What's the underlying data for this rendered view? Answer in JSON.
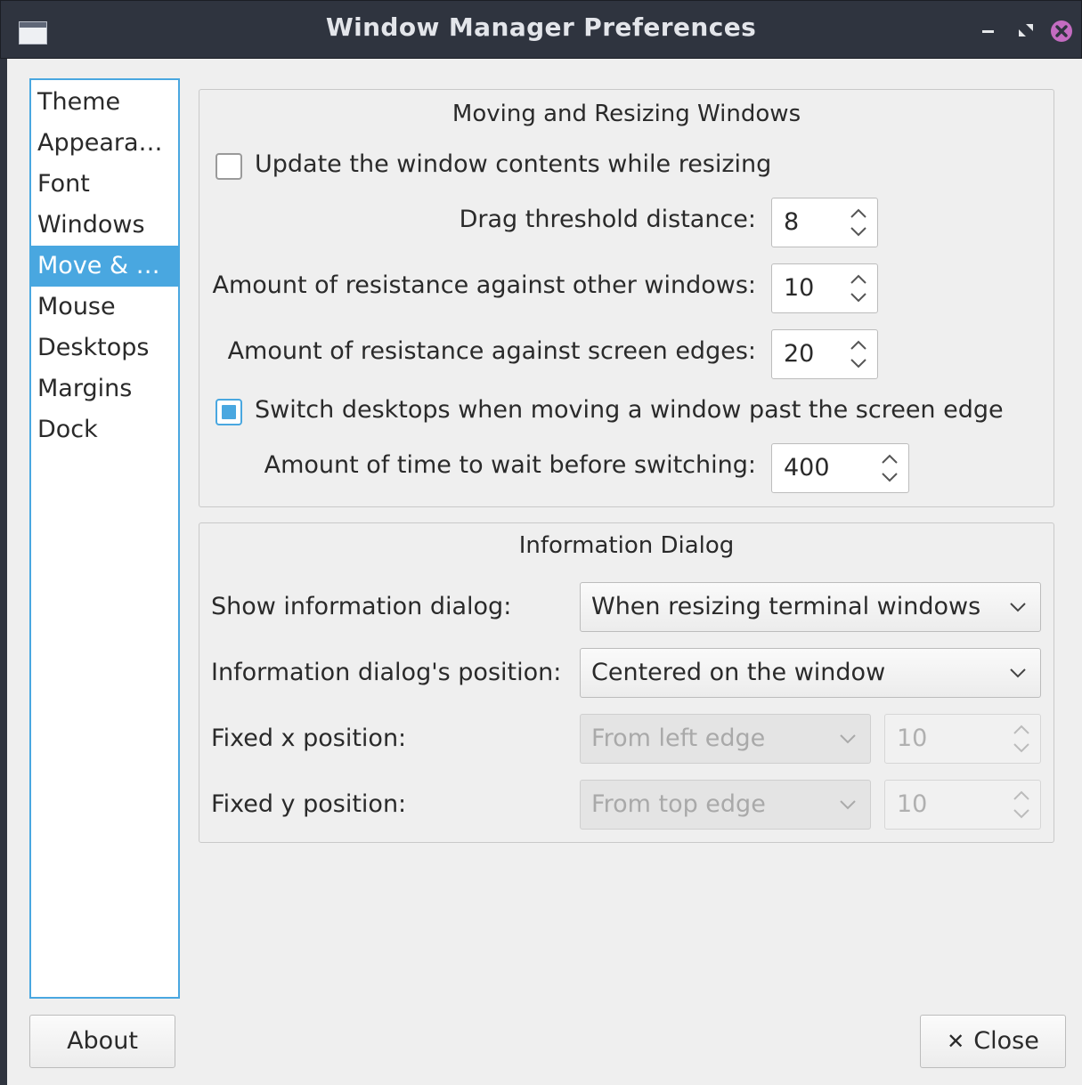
{
  "window": {
    "title": "Window Manager Preferences"
  },
  "sidebar": {
    "items": [
      {
        "label": "Theme",
        "selected": false
      },
      {
        "label": "Appeara…",
        "selected": false
      },
      {
        "label": "Font",
        "selected": false
      },
      {
        "label": "Windows",
        "selected": false
      },
      {
        "label": "Move & …",
        "selected": true
      },
      {
        "label": "Mouse",
        "selected": false
      },
      {
        "label": "Desktops",
        "selected": false
      },
      {
        "label": "Margins",
        "selected": false
      },
      {
        "label": "Dock",
        "selected": false
      }
    ]
  },
  "moving": {
    "title": "Moving and Resizing Windows",
    "update_contents": {
      "label": "Update the window contents while resizing",
      "checked": false
    },
    "drag_threshold": {
      "label": "Drag threshold distance:",
      "value": "8"
    },
    "resist_windows": {
      "label": "Amount of resistance against other windows:",
      "value": "10"
    },
    "resist_edges": {
      "label": "Amount of resistance against screen edges:",
      "value": "20"
    },
    "switch_desktops": {
      "label": "Switch desktops when moving a window past the screen edge",
      "checked": true
    },
    "switch_wait": {
      "label": "Amount of time to wait before switching:",
      "value": "400"
    }
  },
  "info": {
    "title": "Information Dialog",
    "show": {
      "label": "Show information dialog:",
      "value": "When resizing terminal windows"
    },
    "position": {
      "label": "Information dialog's position:",
      "value": "Centered on the window"
    },
    "fixed_x": {
      "label": "Fixed x position:",
      "edge": "From left edge",
      "value": "10"
    },
    "fixed_y": {
      "label": "Fixed y position:",
      "edge": "From top edge",
      "value": "10"
    }
  },
  "buttons": {
    "about": "About",
    "close": "Close"
  },
  "colors": {
    "accent": "#49a7e0",
    "titlebar": "#2f343f",
    "close_icon": "#c46cc1"
  }
}
